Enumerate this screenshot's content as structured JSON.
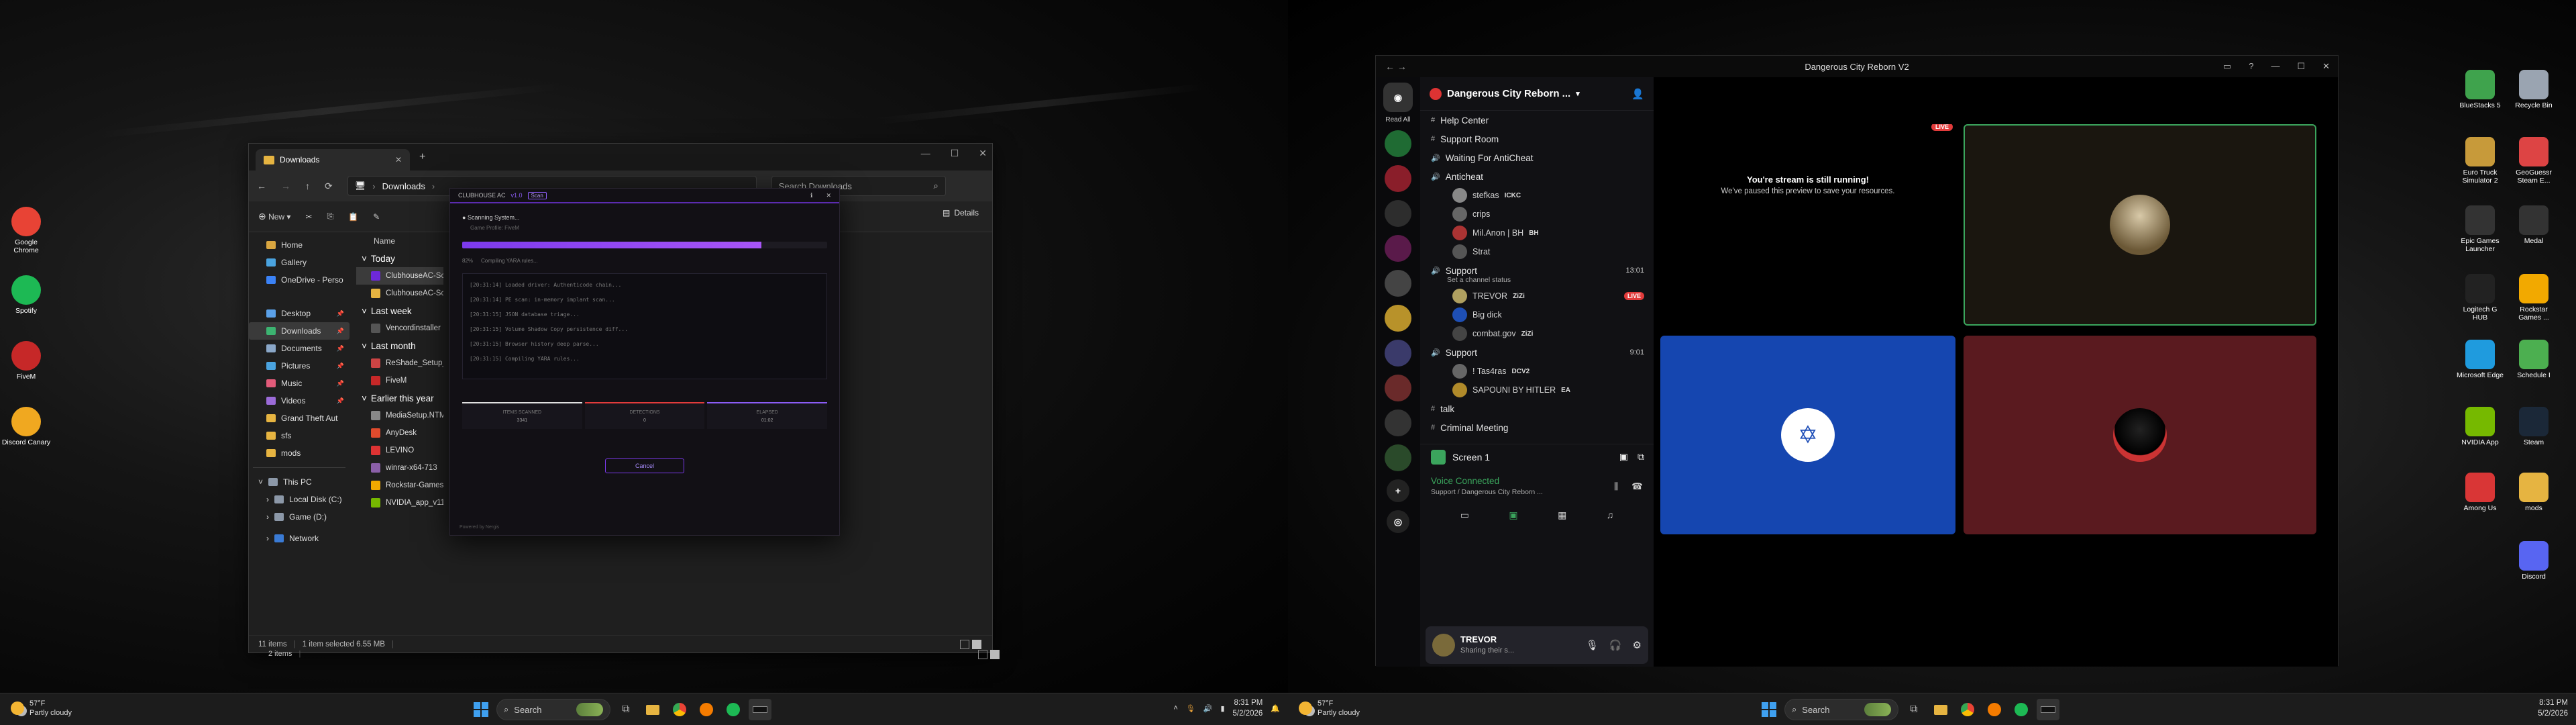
{
  "left": {
    "desktop_icons": [
      {
        "label": "Google Chrome",
        "glyph": "",
        "color": "#e84335"
      },
      {
        "label": "Spotify",
        "glyph": "",
        "color": "#1db954"
      },
      {
        "label": "FiveM",
        "glyph": "",
        "color": "#c62828"
      },
      {
        "label": "Discord Canary",
        "glyph": "",
        "color": "#f0a820"
      }
    ],
    "explorer": {
      "tab_label": "Downloads",
      "path_label": "Downloads",
      "search_placeholder": "Search Downloads",
      "new_label": "New",
      "details_label": "Details",
      "nav_items": [
        {
          "label": "Home",
          "color": "#d9a640"
        },
        {
          "label": "Gallery",
          "color": "#4aa3df"
        },
        {
          "label": "OneDrive - Perso",
          "color": "#3b82f6"
        },
        {
          "label": "Desktop",
          "color": "#5aa0e8"
        },
        {
          "label": "Downloads",
          "color": "#3cb371"
        },
        {
          "label": "Documents",
          "color": "#8aa7c8"
        },
        {
          "label": "Pictures",
          "color": "#4aa3df"
        },
        {
          "label": "Music",
          "color": "#e25b7a"
        },
        {
          "label": "Videos",
          "color": "#9b6bd8"
        },
        {
          "label": "Grand Theft Aut",
          "color": "#e6b441"
        },
        {
          "label": "sfs",
          "color": "#e6b441"
        },
        {
          "label": "mods",
          "color": "#e6b441"
        }
      ],
      "pc_items": [
        {
          "label": "This PC"
        },
        {
          "label": "Local Disk (C:)"
        },
        {
          "label": "Game (D:)"
        },
        {
          "label": "Network"
        }
      ],
      "column_name": "Name",
      "groups": [
        {
          "title": "Today",
          "files": [
            {
              "name": "ClubhouseAC-Scan",
              "color": "#6d28d9",
              "selected": true
            },
            {
              "name": "ClubhouseAC-Scan",
              "color": "#e6b441",
              "selected": false
            }
          ]
        },
        {
          "title": "Last week",
          "files": [
            {
              "name": "Vencordinstaller",
              "color": "#555",
              "selected": false
            }
          ]
        },
        {
          "title": "Last month",
          "files": [
            {
              "name": "ReShade_Setup_6.7.",
              "color": "#c44",
              "selected": false
            },
            {
              "name": "FiveM",
              "color": "#c62828",
              "selected": false
            }
          ]
        },
        {
          "title": "Earlier this year",
          "files": [
            {
              "name": "MediaSetup.NTMbr",
              "color": "#888",
              "selected": false
            },
            {
              "name": "AnyDesk",
              "color": "#e04b2d",
              "selected": false
            },
            {
              "name": "LEVINO",
              "color": "#d33",
              "selected": false
            },
            {
              "name": "winrar-x64-713",
              "color": "#8a5fa8",
              "selected": false
            },
            {
              "name": "Rockstar-Games-La",
              "color": "#f2a900",
              "selected": false
            },
            {
              "name": "NVIDIA_app_v11.0.5",
              "color": "#76b900",
              "selected": false
            }
          ]
        }
      ],
      "status_items": "11 items",
      "status_selected": "1 item selected  6.55 MB",
      "status_items_2": "2 items"
    },
    "anticheat": {
      "title": "CLUBHOUSE AC",
      "version": "v1.0",
      "badge": "Scan",
      "status": "Scanning System...",
      "sub": "Game Profile: FiveM",
      "progress": 0.82,
      "percent_label": "82%",
      "stage_label": "Compiling YARA rules...",
      "log_lines": [
        "[20:31:14] Loaded driver: Authenticode chain...",
        "[20:31:14] PE scan: in-memory implant scan...",
        "[20:31:15] JSON database triage...",
        "[20:31:15] Volume Shadow Copy persistence diff...",
        "[20:31:15] Browser history deep parse...",
        "[20:31:15] Compiling YARA rules..."
      ],
      "stats": [
        {
          "label": "ITEMS SCANNED",
          "value": "3341",
          "color": "#e0e0e0"
        },
        {
          "label": "DETECTIONS",
          "value": "0",
          "color": "#e23b3b"
        },
        {
          "label": "ELAPSED",
          "value": "01:02",
          "color": "#8b5cf6"
        }
      ],
      "cancel_label": "Cancel",
      "footer": "Powered by Nergis"
    },
    "taskbar": {
      "temp": "57°F",
      "weather": "Partly cloudy",
      "search": "Search",
      "time": "8:31 PM",
      "date": "5/2/2026"
    }
  },
  "right": {
    "desktop_icons": [
      {
        "label": "BlueStacks 5",
        "color": "#3fa34d"
      },
      {
        "label": "Recycle Bin",
        "color": "#9aa4b1"
      },
      {
        "label": "Euro Truck Simulator 2",
        "color": "#c79a3a"
      },
      {
        "label": "GeoGuessr Steam E...",
        "color": "#d44"
      },
      {
        "label": "Epic Games Launcher",
        "color": "#333"
      },
      {
        "label": "Medal",
        "color": "#333"
      },
      {
        "label": "Logitech G HUB",
        "color": "#222"
      },
      {
        "label": "Rockstar Games ...",
        "color": "#f2a900"
      },
      {
        "label": "Microsoft Edge",
        "color": "#1f9bde"
      },
      {
        "label": "Schedule I",
        "color": "#4caf50"
      },
      {
        "label": "NVIDIA App",
        "color": "#76b900"
      },
      {
        "label": "Steam",
        "color": "#1b2838"
      },
      {
        "label": "Among Us",
        "color": "#d93636"
      },
      {
        "label": "mods",
        "color": "#e6b441"
      },
      {
        "label": "Discord",
        "color": "#5865f2"
      }
    ],
    "discord": {
      "window_title": "Dangerous City Reborn V2",
      "server_name": "Dangerous City Reborn ...",
      "read_all": "Read All",
      "channels": [
        {
          "type": "text",
          "label": "Help Center"
        },
        {
          "type": "text",
          "label": "Support Room"
        },
        {
          "type": "voice",
          "label": "Waiting For AntiCheat"
        },
        {
          "type": "voice",
          "label": "Anticheat",
          "users": [
            {
              "name": "stefkas",
              "tag": "ICKC",
              "color": "#888"
            },
            {
              "name": "crips",
              "tag": "",
              "color": "#666"
            },
            {
              "name": "Mil.Anon | BH",
              "tag": "BH",
              "color": "#aa3333"
            },
            {
              "name": "Strat",
              "tag": "",
              "color": "#555"
            }
          ]
        },
        {
          "type": "voice",
          "label": "Support",
          "time": "13:01",
          "status": "Set a channel status",
          "users": [
            {
              "name": "TREVOR",
              "tag": "ZiZi",
              "color": "#b0a060",
              "live": true
            },
            {
              "name": "Big dick",
              "tag": "",
              "color": "#1e4fb5"
            },
            {
              "name": "combat.gov",
              "tag": "ZiZi",
              "color": "#444"
            }
          ]
        },
        {
          "type": "voice",
          "label": "Support",
          "time": "9:01",
          "users": [
            {
              "name": "! Tas4ras",
              "tag": "DCV2",
              "color": "#666"
            },
            {
              "name": "SAPOUNI BY HITLER",
              "tag": "EA",
              "color": "#b08a2a"
            }
          ]
        },
        {
          "type": "text",
          "label": "talk"
        },
        {
          "type": "text",
          "label": "Criminal Meeting"
        }
      ],
      "screen_label": "Screen 1",
      "voice_connected": "Voice Connected",
      "voice_sub": "Support / Dangerous City Reborn ...",
      "user_name": "TREVOR",
      "user_status": "Sharing their s...",
      "stream_paused_title": "You're stream is still running!",
      "stream_paused_sub": "We've paused this preview to save your resources.",
      "live_label": "LIVE"
    },
    "taskbar": {
      "temp": "57°F",
      "weather": "Partly cloudy",
      "search": "Search",
      "time": "8:31 PM",
      "date": "5/2/2026"
    }
  }
}
